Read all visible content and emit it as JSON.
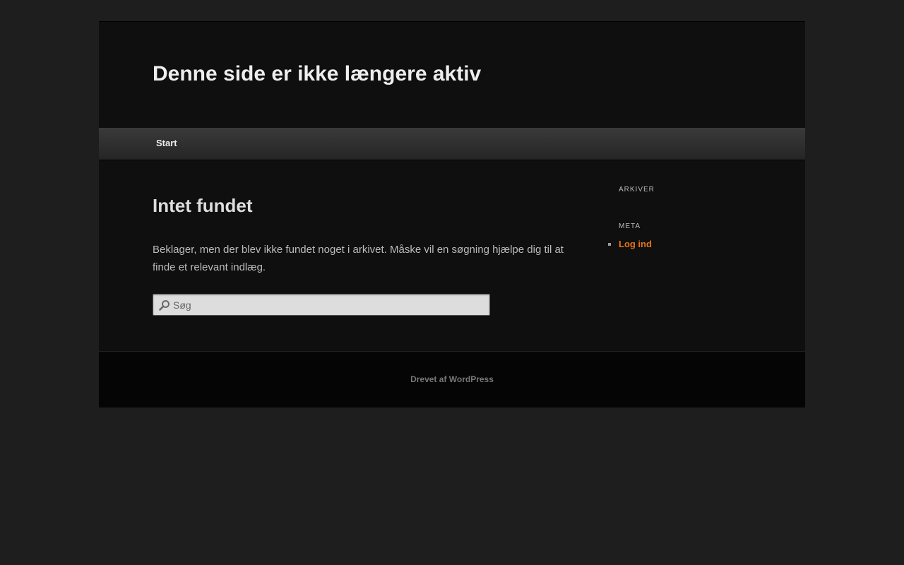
{
  "header": {
    "site_title": "Denne side er ikke længere aktiv"
  },
  "nav": {
    "items": [
      {
        "label": "Start"
      }
    ]
  },
  "main": {
    "title": "Intet fundet",
    "text": "Beklager, men der blev ikke fundet noget i arkivet. Måske vil en søgning hjælpe dig til at finde et relevant indlæg.",
    "search": {
      "placeholder": "Søg",
      "value": ""
    }
  },
  "sidebar": {
    "widgets": [
      {
        "title": "Arkiver"
      },
      {
        "title": "Meta",
        "links": [
          {
            "label": "Log ind"
          }
        ]
      }
    ]
  },
  "footer": {
    "powered_by": "Drevet af WordPress"
  },
  "colors": {
    "accent": "#e4741f",
    "background": "#1e1e1e",
    "page": "#0f0f0f",
    "footer": "#050505"
  },
  "icons": {
    "search": "search-icon"
  }
}
